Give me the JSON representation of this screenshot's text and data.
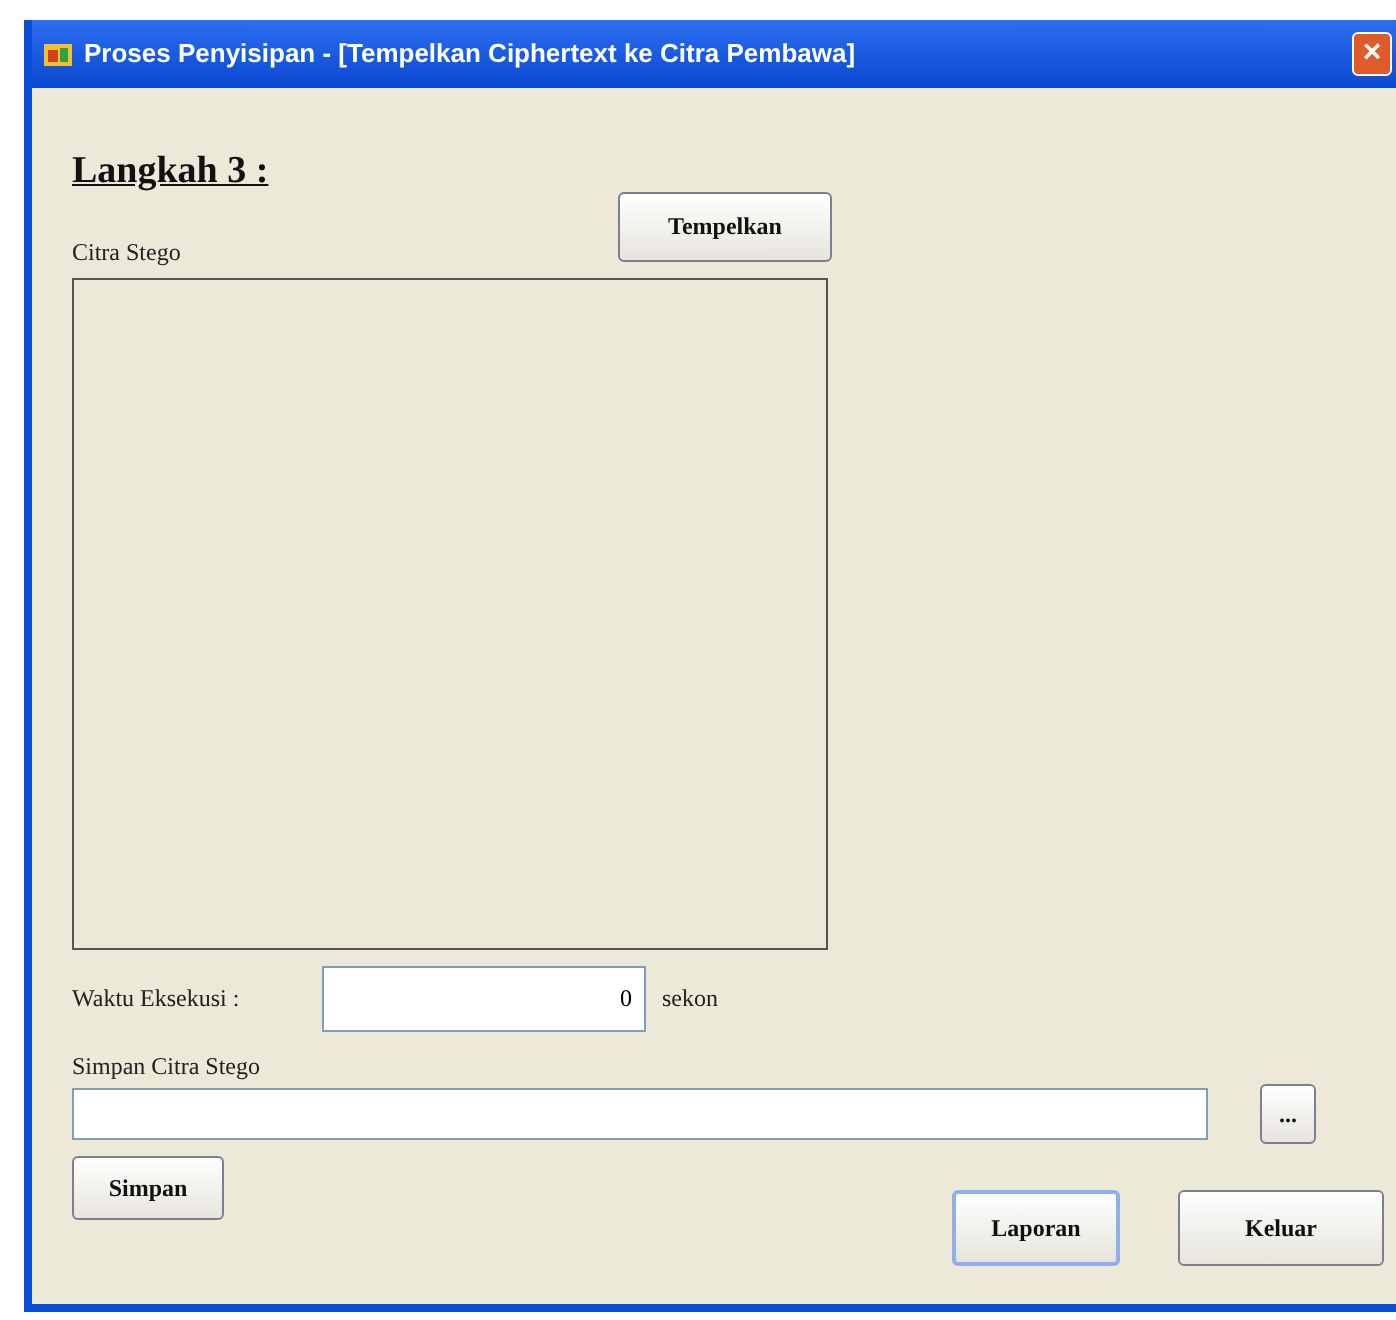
{
  "window": {
    "title": "Proses Penyisipan - [Tempelkan Ciphertext ke Citra Pembawa]",
    "close": "×"
  },
  "heading": "Langkah 3 :",
  "paste_button": "Tempelkan",
  "image_label": "Citra Stego",
  "execution": {
    "label": "Waktu Eksekusi :",
    "value": "0",
    "unit": "sekon"
  },
  "save_path": {
    "label": "Simpan Citra Stego",
    "browse": "..."
  },
  "buttons": [
    {
      "label": "Simpan",
      "kind": "save"
    },
    {
      "label": "Laporan",
      "kind": "report",
      "focused": true
    },
    {
      "label": "Keluar",
      "kind": "exit",
      "focused": false
    }
  ]
}
